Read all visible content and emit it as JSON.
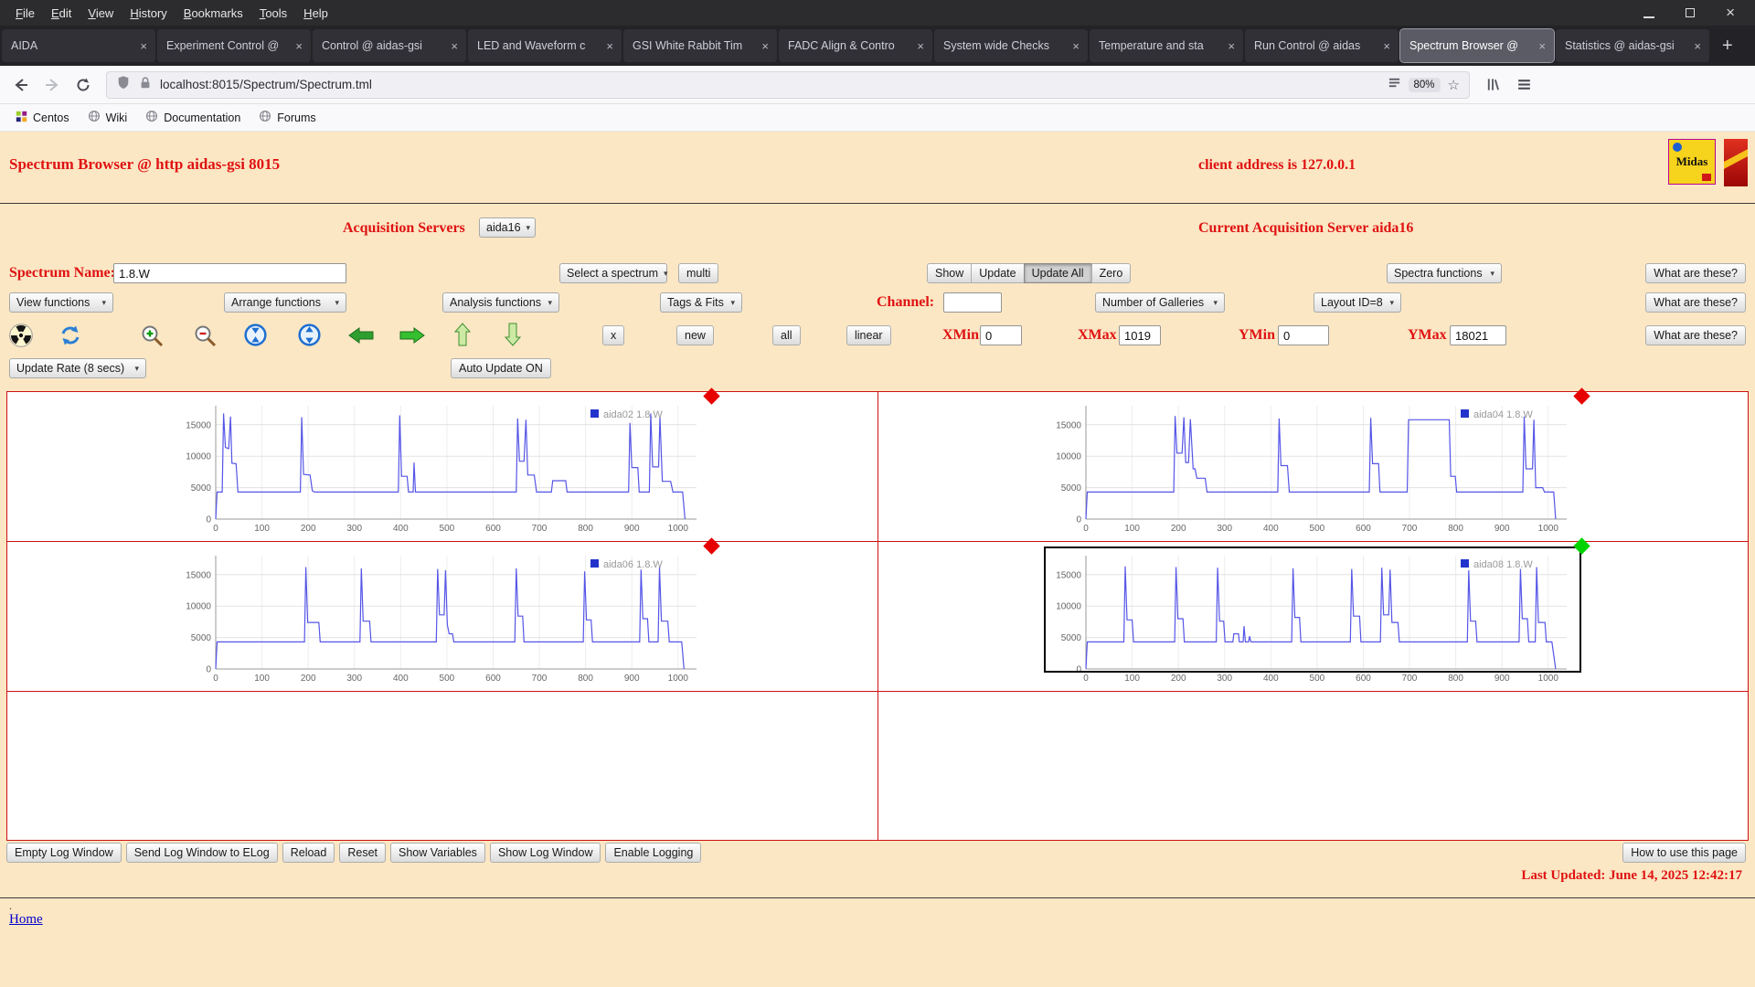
{
  "browser": {
    "menu": [
      "File",
      "Edit",
      "View",
      "History",
      "Bookmarks",
      "Tools",
      "Help"
    ],
    "tabs": [
      {
        "label": "AIDA"
      },
      {
        "label": "Experiment Control @"
      },
      {
        "label": "Control @ aidas-gsi"
      },
      {
        "label": "LED and Waveform c"
      },
      {
        "label": "GSI White Rabbit Tim"
      },
      {
        "label": "FADC Align & Contro"
      },
      {
        "label": "System wide Checks"
      },
      {
        "label": "Temperature and sta"
      },
      {
        "label": "Run Control @ aidas"
      },
      {
        "label": "Spectrum Browser @"
      },
      {
        "label": "Statistics @ aidas-gsi"
      }
    ],
    "url": "localhost:8015/Spectrum/Spectrum.tml",
    "zoom": "80%",
    "bookmarks": [
      "Centos",
      "Wiki",
      "Documentation",
      "Forums"
    ]
  },
  "page": {
    "title": "Spectrum Browser @ http aidas-gsi 8015",
    "client_address": "client address is 127.0.0.1",
    "logo_text": "Midas",
    "acq_servers_label": "Acquisition Servers",
    "acq_server_selected": "aida16",
    "current_server": "Current Acquisition Server aida16",
    "spectrum_name_label": "Spectrum Name:",
    "spectrum_name": "1.8.W",
    "select_spectrum": "Select a spectrum",
    "multi": "multi",
    "show": "Show",
    "update": "Update",
    "update_all": "Update All",
    "zero": "Zero",
    "spectra_functions": "Spectra functions",
    "what_are_these": "What are these?",
    "view_functions": "View functions",
    "arrange_functions": "Arrange functions",
    "analysis_functions": "Analysis functions",
    "tags_fits": "Tags & Fits",
    "channel_label": "Channel:",
    "channel": "",
    "num_galleries": "Number of Galleries",
    "layout_id": "Layout ID=8",
    "x_btn": "x",
    "new_btn": "new",
    "all_btn": "all",
    "linear_btn": "linear",
    "xmin_label": "XMin",
    "xmin": "0",
    "xmax_label": "XMax",
    "xmax": "1019",
    "ymin_label": "YMin",
    "ymin": "0",
    "ymax_label": "YMax",
    "ymax": "18021",
    "update_rate": "Update Rate (8 secs)",
    "auto_update": "Auto Update ON",
    "footer": {
      "empty_log": "Empty Log Window",
      "send_log": "Send Log Window to ELog",
      "reload": "Reload",
      "reset": "Reset",
      "show_vars": "Show Variables",
      "show_log": "Show Log Window",
      "enable_logging": "Enable Logging",
      "how_to": "How to use this page"
    },
    "last_updated": "Last Updated: June 14, 2025 12:42:17",
    "dot": ".",
    "home": "Home"
  },
  "chart_data": [
    {
      "type": "line",
      "title": "aida02 1.8.W",
      "legend_position": "top-right",
      "xlabel": "",
      "ylabel": "",
      "grid": true,
      "xlim": [
        0,
        1019
      ],
      "ylim": [
        0,
        18021
      ],
      "x_axis_max": 1040,
      "y_axis_max": 18021,
      "xticks": [
        0,
        100,
        200,
        300,
        400,
        500,
        600,
        700,
        800,
        900,
        1000
      ],
      "yticks": [
        0,
        5000,
        10000,
        15000
      ],
      "line_color": "#5555e8",
      "marker_color": "#e60000",
      "selected": false,
      "x": [
        0,
        3,
        14,
        17,
        21,
        28,
        32,
        35,
        44,
        48,
        183,
        186,
        190,
        204,
        209,
        214,
        276,
        395,
        398,
        402,
        414,
        417,
        427,
        429,
        432,
        650,
        653,
        657,
        667,
        671,
        675,
        689,
        694,
        726,
        729,
        757,
        760,
        893,
        896,
        900,
        913,
        916,
        938,
        941,
        945,
        958,
        961,
        966,
        984,
        989,
        1000,
        1010,
        1015
      ],
      "y": [
        0,
        4300,
        4300,
        16800,
        11400,
        11200,
        16300,
        8900,
        8800,
        4300,
        4300,
        16200,
        7100,
        7000,
        4500,
        4300,
        4300,
        4300,
        16500,
        6800,
        6800,
        4300,
        4300,
        9000,
        4300,
        4300,
        16000,
        9200,
        9200,
        15800,
        7000,
        7000,
        4300,
        4300,
        6100,
        6100,
        4300,
        4300,
        15300,
        8200,
        8200,
        4300,
        4300,
        16800,
        8300,
        8300,
        16200,
        6000,
        6000,
        4300,
        4300,
        4300,
        0
      ]
    },
    {
      "type": "line",
      "title": "aida04 1.8.W",
      "legend_position": "top-right",
      "xlabel": "",
      "ylabel": "",
      "grid": true,
      "xlim": [
        0,
        1019
      ],
      "ylim": [
        0,
        18021
      ],
      "x_axis_max": 1040,
      "y_axis_max": 18021,
      "xticks": [
        0,
        100,
        200,
        300,
        400,
        500,
        600,
        700,
        800,
        900,
        1000
      ],
      "yticks": [
        0,
        5000,
        10000,
        15000
      ],
      "line_color": "#5555e8",
      "marker_color": "#e60000",
      "selected": false,
      "x": [
        0,
        3,
        190,
        193,
        197,
        208,
        212,
        216,
        222,
        226,
        232,
        236,
        240,
        258,
        262,
        300,
        415,
        418,
        422,
        436,
        440,
        613,
        616,
        620,
        633,
        636,
        695,
        698,
        786,
        789,
        799,
        802,
        945,
        948,
        952,
        966,
        969,
        973,
        988,
        992,
        1005,
        1012,
        1016
      ],
      "y": [
        0,
        4300,
        4300,
        16400,
        10500,
        10500,
        16200,
        9000,
        9000,
        15900,
        8000,
        8000,
        6500,
        6500,
        4300,
        4300,
        4300,
        16000,
        8500,
        8500,
        4300,
        4300,
        16100,
        8800,
        8800,
        4300,
        4300,
        15800,
        15800,
        6800,
        6800,
        4300,
        4300,
        16300,
        8000,
        8000,
        15800,
        5000,
        5000,
        4300,
        4300,
        4300,
        0
      ]
    },
    {
      "type": "line",
      "title": "aida06 1.8.W",
      "legend_position": "top-right",
      "xlabel": "",
      "ylabel": "",
      "grid": true,
      "xlim": [
        0,
        1019
      ],
      "ylim": [
        0,
        18021
      ],
      "x_axis_max": 1040,
      "y_axis_max": 18021,
      "xticks": [
        0,
        100,
        200,
        300,
        400,
        500,
        600,
        700,
        800,
        900,
        1000
      ],
      "yticks": [
        0,
        5000,
        10000,
        15000
      ],
      "line_color": "#5555e8",
      "marker_color": "#e60000",
      "selected": false,
      "x": [
        0,
        3,
        192,
        195,
        199,
        223,
        226,
        312,
        315,
        319,
        333,
        336,
        477,
        480,
        484,
        494,
        497,
        501,
        505,
        512,
        515,
        647,
        650,
        654,
        664,
        667,
        795,
        798,
        802,
        812,
        815,
        917,
        920,
        924,
        934,
        937,
        957,
        960,
        964,
        978,
        981,
        1000,
        1008,
        1013
      ],
      "y": [
        0,
        4300,
        4300,
        16200,
        7400,
        7400,
        4300,
        4300,
        16000,
        7600,
        7600,
        4300,
        4300,
        15900,
        8600,
        8600,
        15700,
        7000,
        5600,
        5600,
        4300,
        4300,
        16000,
        8400,
        8400,
        4300,
        4300,
        15500,
        7800,
        7800,
        4300,
        4300,
        15800,
        8000,
        8000,
        4300,
        4300,
        16200,
        7600,
        7600,
        4300,
        4300,
        4300,
        0
      ]
    },
    {
      "type": "line",
      "title": "aida08 1.8.W",
      "legend_position": "top-right",
      "xlabel": "",
      "ylabel": "",
      "grid": true,
      "xlim": [
        0,
        1019
      ],
      "ylim": [
        0,
        18021
      ],
      "x_axis_max": 1040,
      "y_axis_max": 18021,
      "xticks": [
        0,
        100,
        200,
        300,
        400,
        500,
        600,
        700,
        800,
        900,
        1000
      ],
      "yticks": [
        0,
        5000,
        10000,
        15000
      ],
      "line_color": "#5555e8",
      "marker_color": "#00d400",
      "selected": true,
      "x": [
        0,
        3,
        82,
        85,
        89,
        100,
        103,
        192,
        195,
        199,
        210,
        213,
        282,
        285,
        289,
        298,
        301,
        318,
        320,
        330,
        332,
        340,
        342,
        345,
        352,
        354,
        357,
        445,
        448,
        452,
        462,
        465,
        572,
        575,
        579,
        592,
        595,
        637,
        640,
        644,
        655,
        658,
        662,
        675,
        678,
        825,
        828,
        832,
        843,
        846,
        937,
        940,
        944,
        955,
        958,
        972,
        975,
        979,
        993,
        996,
        1008,
        1016
      ],
      "y": [
        0,
        4300,
        4300,
        16300,
        7800,
        7800,
        4300,
        4300,
        16200,
        8000,
        8000,
        4300,
        4300,
        16100,
        7600,
        7600,
        4300,
        4300,
        5600,
        5600,
        4300,
        4300,
        6800,
        4300,
        4300,
        5200,
        4300,
        4300,
        16000,
        8200,
        8200,
        4300,
        4300,
        15900,
        8400,
        8400,
        4300,
        4300,
        16100,
        8600,
        8600,
        15800,
        7400,
        7400,
        4300,
        4300,
        15700,
        7600,
        7600,
        4300,
        4300,
        15900,
        8000,
        8000,
        4300,
        4300,
        16200,
        7400,
        7400,
        4300,
        4300,
        0
      ]
    }
  ]
}
